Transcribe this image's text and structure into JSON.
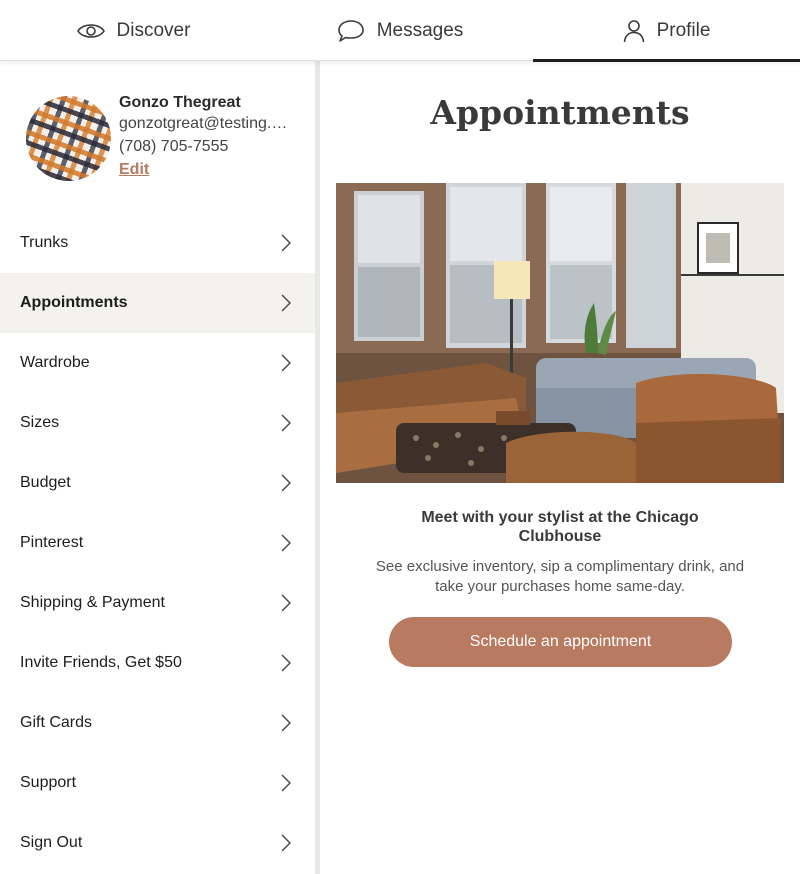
{
  "nav": {
    "tabs": [
      {
        "label": "Discover",
        "icon": "eye-icon"
      },
      {
        "label": "Messages",
        "icon": "chat-bubble-icon"
      },
      {
        "label": "Profile",
        "icon": "user-icon"
      }
    ],
    "active": "Profile"
  },
  "profile": {
    "name": "Gonzo Thegreat",
    "email": "gonzotgreat@testing.com",
    "phone": "(708) 705-7555",
    "edit_label": "Edit"
  },
  "menu": {
    "items": [
      {
        "label": "Trunks"
      },
      {
        "label": "Appointments"
      },
      {
        "label": "Wardrobe"
      },
      {
        "label": "Sizes"
      },
      {
        "label": "Budget"
      },
      {
        "label": "Pinterest"
      },
      {
        "label": "Shipping & Payment"
      },
      {
        "label": "Invite Friends, Get $50"
      },
      {
        "label": "Gift Cards"
      },
      {
        "label": "Support"
      },
      {
        "label": "Sign Out"
      }
    ],
    "active": "Appointments"
  },
  "main": {
    "title": "Appointments",
    "headline": "Meet with your stylist at the Chicago Clubhouse",
    "description": "See exclusive inventory, sip a complimentary drink, and take your purchases home same-day.",
    "cta_label": "Schedule an appointment"
  },
  "colors": {
    "accent": "#b87a60",
    "active_row_bg": "#f3f2ee",
    "text": "#1d1d1d"
  }
}
